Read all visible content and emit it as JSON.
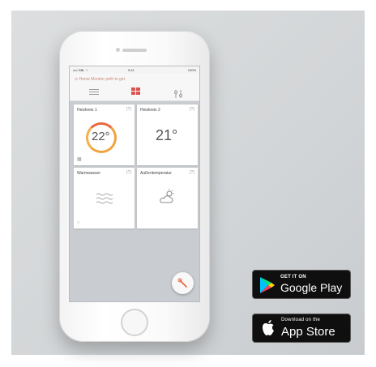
{
  "phone": {
    "statusbar": {
      "left": "•••• DBL ⌔",
      "center": "9:41",
      "right": "100%"
    },
    "hint": "⊙ Home Monitor peth to get",
    "tiles": [
      {
        "name": "Heizkreis 1",
        "temp": "22°",
        "menu": "(?)",
        "icon": "calendar-icon"
      },
      {
        "name": "Heizkreis 2",
        "temp": "21°",
        "menu": "(?)"
      },
      {
        "name": "Warmwasser",
        "menu": "(?)",
        "icon": "water-waves-icon"
      },
      {
        "name": "Außentemperatur",
        "menu": "(?)",
        "icon": "cloud-sun-icon"
      }
    ]
  },
  "badges": {
    "google": {
      "small": "GET IT ON",
      "big": "Google Play"
    },
    "apple": {
      "small": "Download on the",
      "big": "App Store"
    }
  },
  "colors": {
    "accent": "#d9534f",
    "ring_orange": "#f0a33c",
    "ring_red": "#e8683f"
  }
}
